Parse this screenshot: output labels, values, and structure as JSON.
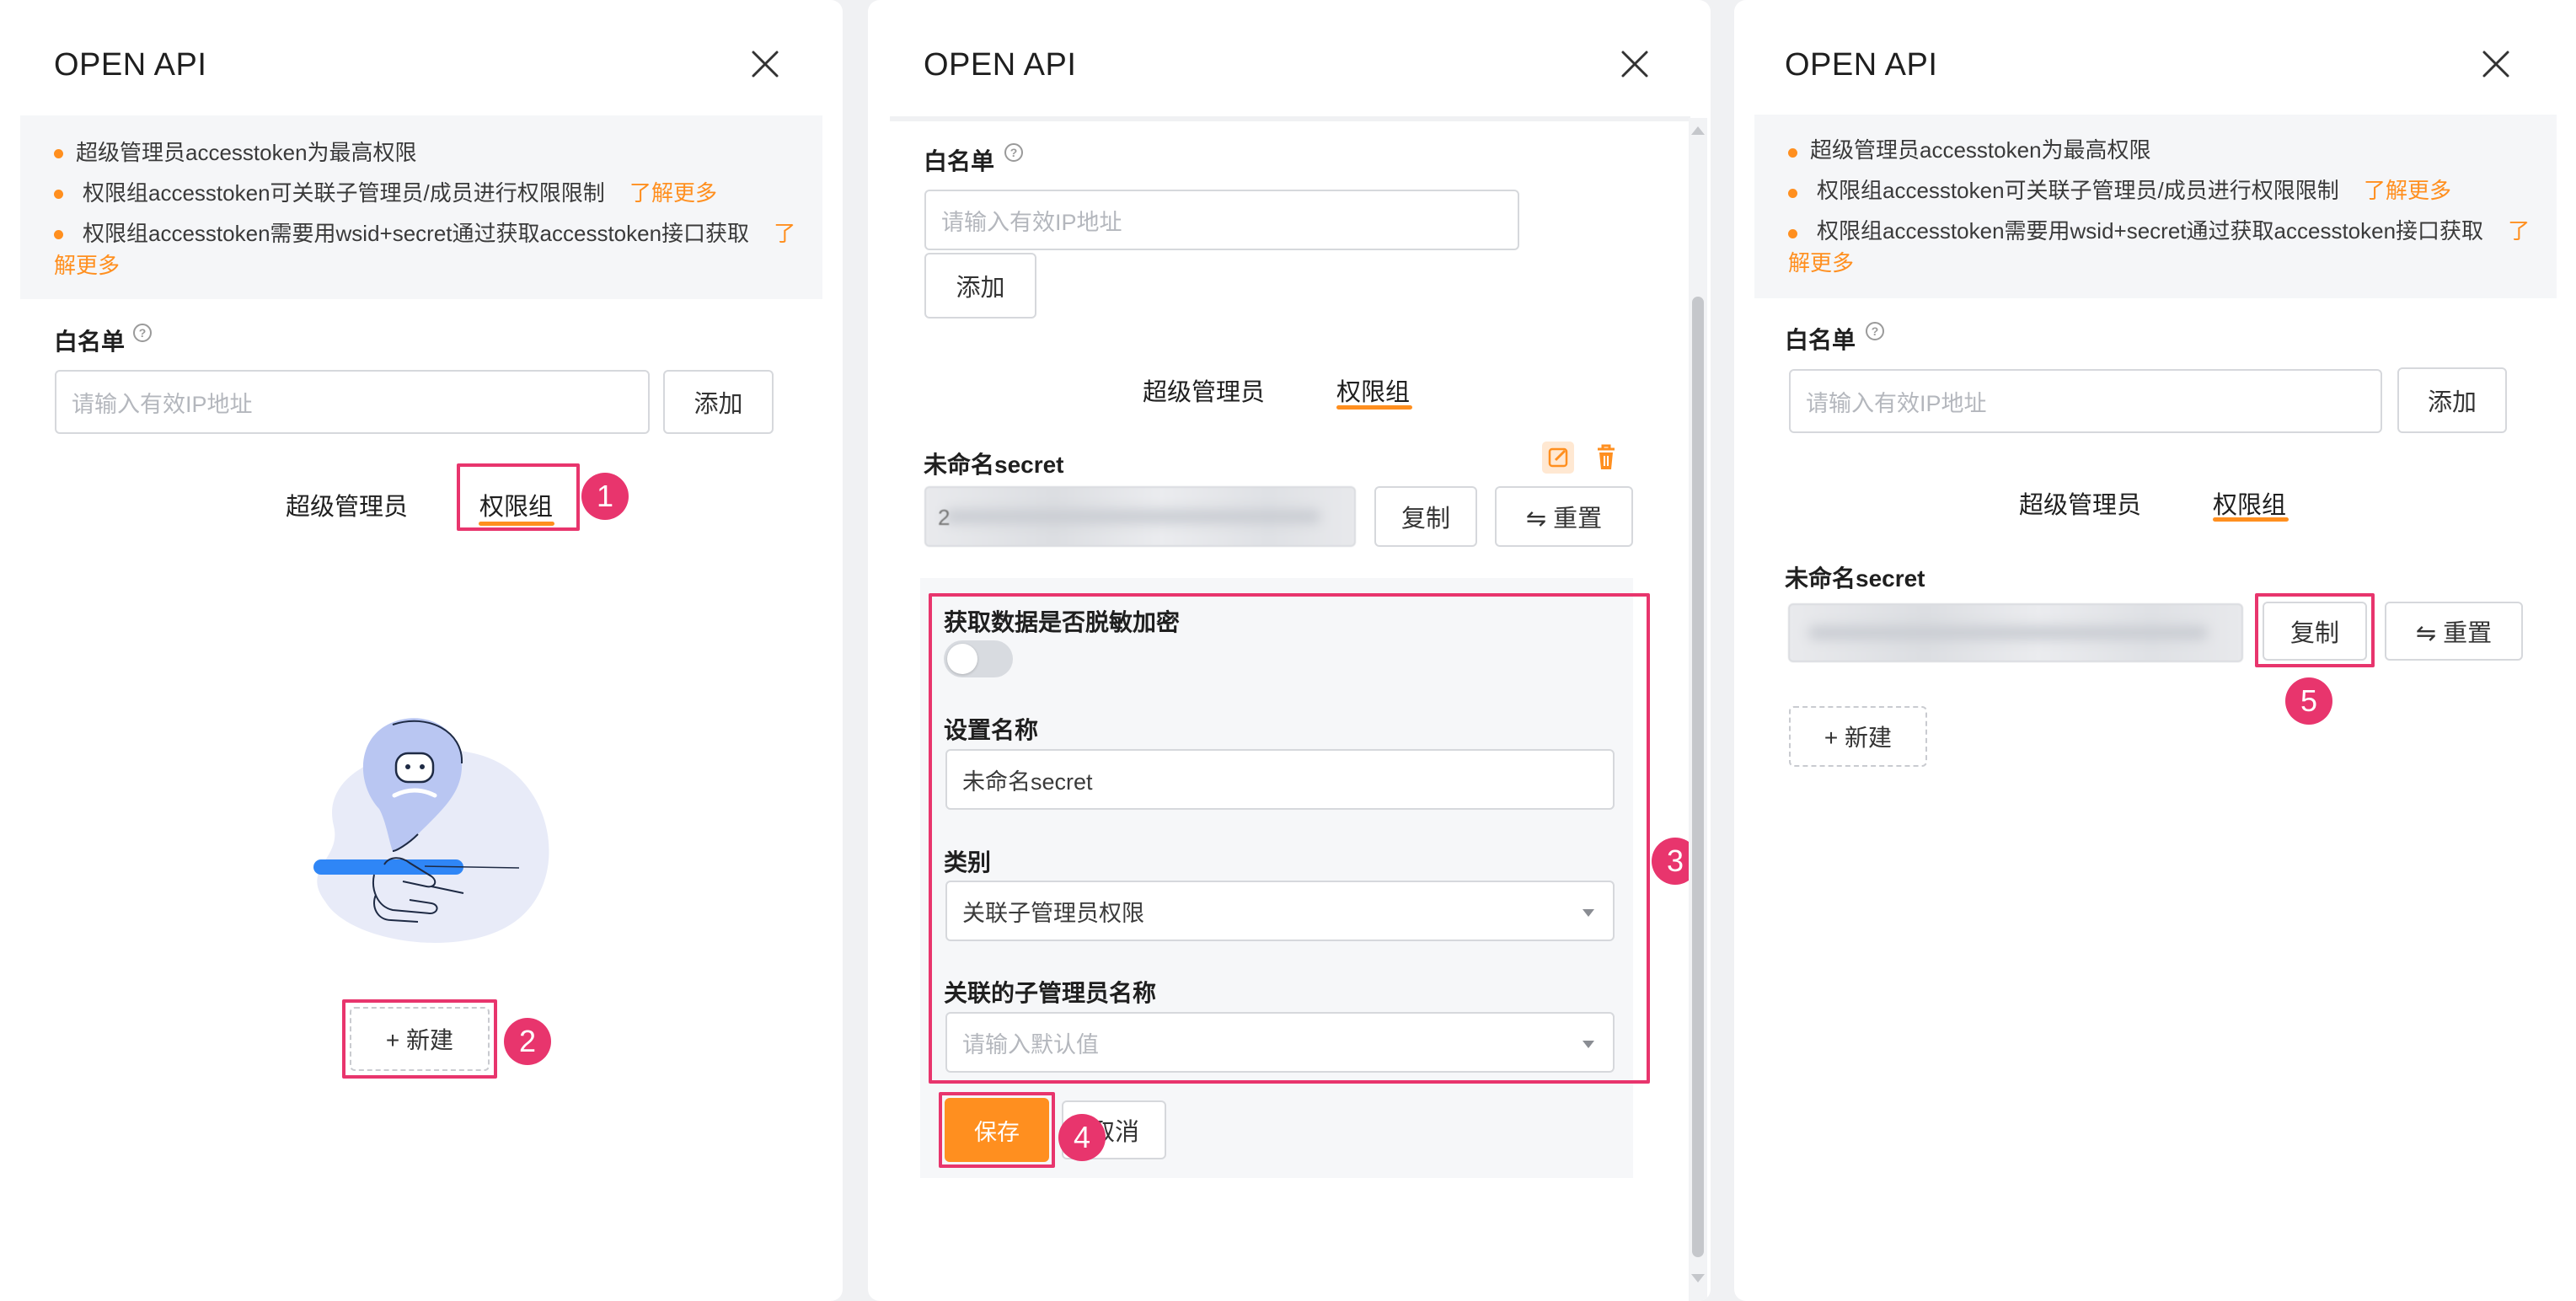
{
  "dialog": {
    "title": "OPEN API",
    "notice": {
      "line1": "超级管理员accesstoken为最高权限",
      "line2": "权限组accesstoken可关联子管理员/成员进行权限限制",
      "line2_link": "了解更多",
      "line3": "权限组accesstoken需要用wsid+secret通过获取accesstoken接口获取",
      "line3_link_a": "了",
      "line3_link_b": "解更多"
    },
    "whitelist": {
      "label": "白名单",
      "help_glyph": "?",
      "placeholder": "请输入有效IP地址",
      "add_label": "添加"
    },
    "tabs": [
      "超级管理员",
      "权限组"
    ],
    "active_tab": "权限组",
    "new_label": "+ 新建"
  },
  "secret": {
    "name": "未命名secret",
    "copy_label": "复制",
    "reset_label": "⇋ 重置",
    "masked_prefix": "2"
  },
  "form": {
    "desensitize_label": "获取数据是否脱敏加密",
    "desensitize_on": false,
    "name_label": "设置名称",
    "name_value": "未命名secret",
    "category_label": "类别",
    "category_value": "关联子管理员权限",
    "sub_admin_label": "关联的子管理员名称",
    "sub_admin_placeholder": "请输入默认值",
    "save_label": "保存",
    "cancel_label": "取消",
    "cancel_visible": "取消"
  },
  "callouts": [
    "1",
    "2",
    "3",
    "4",
    "5"
  ],
  "colors": {
    "accent": "#ff8f1f",
    "highlight": "#e8356d",
    "illustration_blue": "#2f86f6"
  }
}
